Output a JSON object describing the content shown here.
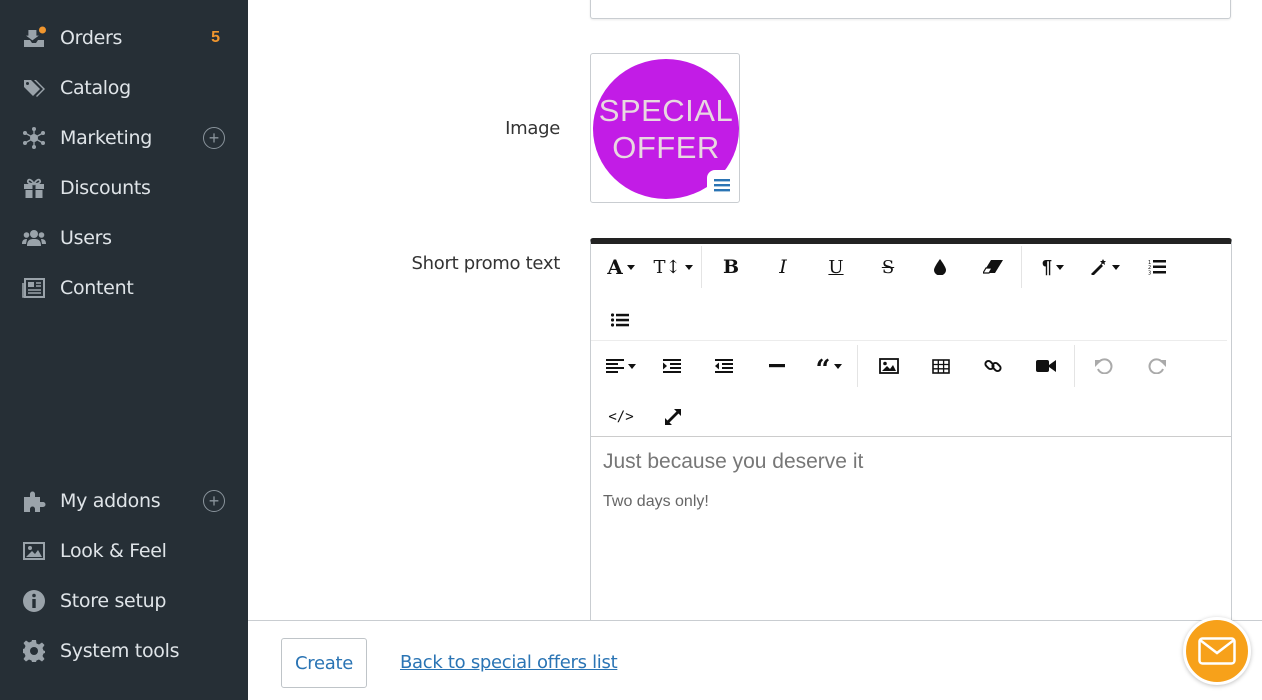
{
  "sidebar": {
    "items": [
      {
        "label": "Orders",
        "icon": "orders-icon",
        "badge": "5"
      },
      {
        "label": "Catalog",
        "icon": "tag-icon"
      },
      {
        "label": "Marketing",
        "icon": "network-icon",
        "has_add": true
      },
      {
        "label": "Discounts",
        "icon": "gift-icon"
      },
      {
        "label": "Users",
        "icon": "users-icon"
      },
      {
        "label": "Content",
        "icon": "newspaper-icon"
      },
      {
        "label": "My addons",
        "icon": "puzzle-icon",
        "has_add": true
      },
      {
        "label": "Look & Feel",
        "icon": "image-icon"
      },
      {
        "label": "Store setup",
        "icon": "info-icon"
      },
      {
        "label": "System tools",
        "icon": "gear-icon"
      }
    ],
    "colors": {
      "background": "#262f36",
      "badge": "#f0962e",
      "notification_dot": "#f0962e"
    }
  },
  "form": {
    "image_label": "Image",
    "image_text_line1": "SPECIAL",
    "image_text_line2": "OFFER",
    "promo_label": "Short promo text"
  },
  "editor": {
    "heading": "Just because you deserve it",
    "paragraph": "Two days only!",
    "toolbar_icons": [
      "font-icon",
      "font-size-icon",
      "bold-icon",
      "italic-icon",
      "underline-icon",
      "strikethrough-icon",
      "color-drop-icon",
      "eraser-icon",
      "paragraph-icon",
      "magic-wand-icon",
      "ordered-list-icon",
      "unordered-list-icon",
      "align-icon",
      "indent-icon",
      "outdent-icon",
      "horizontal-rule-icon",
      "quote-icon",
      "image-icon",
      "table-icon",
      "link-icon",
      "video-icon",
      "undo-icon",
      "redo-icon",
      "code-view-icon",
      "fullscreen-icon"
    ]
  },
  "footer": {
    "create_label": "Create",
    "back_link": "Back to special offers list"
  },
  "colors": {
    "link": "#2a74b4",
    "offer_circle": "#c21ce6",
    "chat_button": "#f7a11a"
  }
}
